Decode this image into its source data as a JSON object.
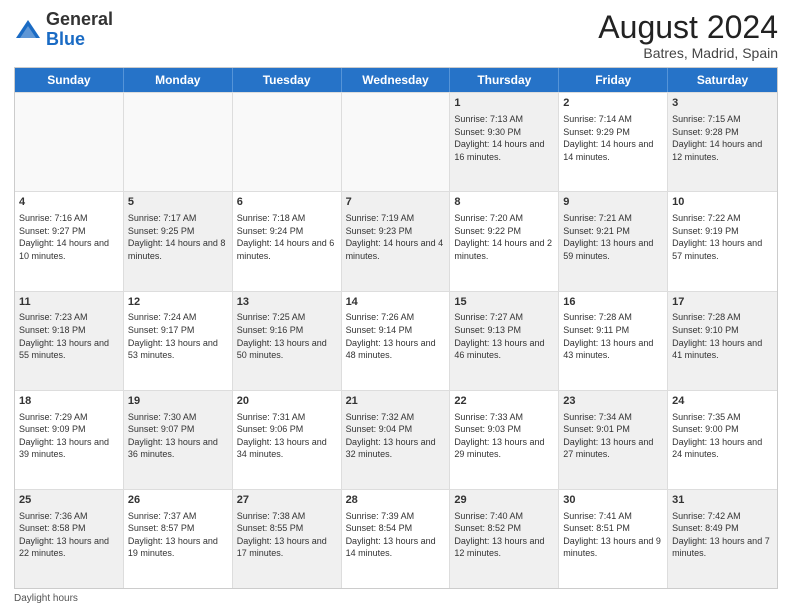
{
  "header": {
    "logo_general": "General",
    "logo_blue": "Blue",
    "month_year": "August 2024",
    "location": "Batres, Madrid, Spain"
  },
  "days_of_week": [
    "Sunday",
    "Monday",
    "Tuesday",
    "Wednesday",
    "Thursday",
    "Friday",
    "Saturday"
  ],
  "weeks": [
    [
      {
        "day": "",
        "sunrise": "",
        "sunset": "",
        "daylight": "",
        "shaded": false,
        "empty": true
      },
      {
        "day": "",
        "sunrise": "",
        "sunset": "",
        "daylight": "",
        "shaded": false,
        "empty": true
      },
      {
        "day": "",
        "sunrise": "",
        "sunset": "",
        "daylight": "",
        "shaded": false,
        "empty": true
      },
      {
        "day": "",
        "sunrise": "",
        "sunset": "",
        "daylight": "",
        "shaded": false,
        "empty": true
      },
      {
        "day": "1",
        "sunrise": "Sunrise: 7:13 AM",
        "sunset": "Sunset: 9:30 PM",
        "daylight": "Daylight: 14 hours and 16 minutes.",
        "shaded": true,
        "empty": false
      },
      {
        "day": "2",
        "sunrise": "Sunrise: 7:14 AM",
        "sunset": "Sunset: 9:29 PM",
        "daylight": "Daylight: 14 hours and 14 minutes.",
        "shaded": false,
        "empty": false
      },
      {
        "day": "3",
        "sunrise": "Sunrise: 7:15 AM",
        "sunset": "Sunset: 9:28 PM",
        "daylight": "Daylight: 14 hours and 12 minutes.",
        "shaded": true,
        "empty": false
      }
    ],
    [
      {
        "day": "4",
        "sunrise": "Sunrise: 7:16 AM",
        "sunset": "Sunset: 9:27 PM",
        "daylight": "Daylight: 14 hours and 10 minutes.",
        "shaded": false,
        "empty": false
      },
      {
        "day": "5",
        "sunrise": "Sunrise: 7:17 AM",
        "sunset": "Sunset: 9:25 PM",
        "daylight": "Daylight: 14 hours and 8 minutes.",
        "shaded": true,
        "empty": false
      },
      {
        "day": "6",
        "sunrise": "Sunrise: 7:18 AM",
        "sunset": "Sunset: 9:24 PM",
        "daylight": "Daylight: 14 hours and 6 minutes.",
        "shaded": false,
        "empty": false
      },
      {
        "day": "7",
        "sunrise": "Sunrise: 7:19 AM",
        "sunset": "Sunset: 9:23 PM",
        "daylight": "Daylight: 14 hours and 4 minutes.",
        "shaded": true,
        "empty": false
      },
      {
        "day": "8",
        "sunrise": "Sunrise: 7:20 AM",
        "sunset": "Sunset: 9:22 PM",
        "daylight": "Daylight: 14 hours and 2 minutes.",
        "shaded": false,
        "empty": false
      },
      {
        "day": "9",
        "sunrise": "Sunrise: 7:21 AM",
        "sunset": "Sunset: 9:21 PM",
        "daylight": "Daylight: 13 hours and 59 minutes.",
        "shaded": true,
        "empty": false
      },
      {
        "day": "10",
        "sunrise": "Sunrise: 7:22 AM",
        "sunset": "Sunset: 9:19 PM",
        "daylight": "Daylight: 13 hours and 57 minutes.",
        "shaded": false,
        "empty": false
      }
    ],
    [
      {
        "day": "11",
        "sunrise": "Sunrise: 7:23 AM",
        "sunset": "Sunset: 9:18 PM",
        "daylight": "Daylight: 13 hours and 55 minutes.",
        "shaded": true,
        "empty": false
      },
      {
        "day": "12",
        "sunrise": "Sunrise: 7:24 AM",
        "sunset": "Sunset: 9:17 PM",
        "daylight": "Daylight: 13 hours and 53 minutes.",
        "shaded": false,
        "empty": false
      },
      {
        "day": "13",
        "sunrise": "Sunrise: 7:25 AM",
        "sunset": "Sunset: 9:16 PM",
        "daylight": "Daylight: 13 hours and 50 minutes.",
        "shaded": true,
        "empty": false
      },
      {
        "day": "14",
        "sunrise": "Sunrise: 7:26 AM",
        "sunset": "Sunset: 9:14 PM",
        "daylight": "Daylight: 13 hours and 48 minutes.",
        "shaded": false,
        "empty": false
      },
      {
        "day": "15",
        "sunrise": "Sunrise: 7:27 AM",
        "sunset": "Sunset: 9:13 PM",
        "daylight": "Daylight: 13 hours and 46 minutes.",
        "shaded": true,
        "empty": false
      },
      {
        "day": "16",
        "sunrise": "Sunrise: 7:28 AM",
        "sunset": "Sunset: 9:11 PM",
        "daylight": "Daylight: 13 hours and 43 minutes.",
        "shaded": false,
        "empty": false
      },
      {
        "day": "17",
        "sunrise": "Sunrise: 7:28 AM",
        "sunset": "Sunset: 9:10 PM",
        "daylight": "Daylight: 13 hours and 41 minutes.",
        "shaded": true,
        "empty": false
      }
    ],
    [
      {
        "day": "18",
        "sunrise": "Sunrise: 7:29 AM",
        "sunset": "Sunset: 9:09 PM",
        "daylight": "Daylight: 13 hours and 39 minutes.",
        "shaded": false,
        "empty": false
      },
      {
        "day": "19",
        "sunrise": "Sunrise: 7:30 AM",
        "sunset": "Sunset: 9:07 PM",
        "daylight": "Daylight: 13 hours and 36 minutes.",
        "shaded": true,
        "empty": false
      },
      {
        "day": "20",
        "sunrise": "Sunrise: 7:31 AM",
        "sunset": "Sunset: 9:06 PM",
        "daylight": "Daylight: 13 hours and 34 minutes.",
        "shaded": false,
        "empty": false
      },
      {
        "day": "21",
        "sunrise": "Sunrise: 7:32 AM",
        "sunset": "Sunset: 9:04 PM",
        "daylight": "Daylight: 13 hours and 32 minutes.",
        "shaded": true,
        "empty": false
      },
      {
        "day": "22",
        "sunrise": "Sunrise: 7:33 AM",
        "sunset": "Sunset: 9:03 PM",
        "daylight": "Daylight: 13 hours and 29 minutes.",
        "shaded": false,
        "empty": false
      },
      {
        "day": "23",
        "sunrise": "Sunrise: 7:34 AM",
        "sunset": "Sunset: 9:01 PM",
        "daylight": "Daylight: 13 hours and 27 minutes.",
        "shaded": true,
        "empty": false
      },
      {
        "day": "24",
        "sunrise": "Sunrise: 7:35 AM",
        "sunset": "Sunset: 9:00 PM",
        "daylight": "Daylight: 13 hours and 24 minutes.",
        "shaded": false,
        "empty": false
      }
    ],
    [
      {
        "day": "25",
        "sunrise": "Sunrise: 7:36 AM",
        "sunset": "Sunset: 8:58 PM",
        "daylight": "Daylight: 13 hours and 22 minutes.",
        "shaded": true,
        "empty": false
      },
      {
        "day": "26",
        "sunrise": "Sunrise: 7:37 AM",
        "sunset": "Sunset: 8:57 PM",
        "daylight": "Daylight: 13 hours and 19 minutes.",
        "shaded": false,
        "empty": false
      },
      {
        "day": "27",
        "sunrise": "Sunrise: 7:38 AM",
        "sunset": "Sunset: 8:55 PM",
        "daylight": "Daylight: 13 hours and 17 minutes.",
        "shaded": true,
        "empty": false
      },
      {
        "day": "28",
        "sunrise": "Sunrise: 7:39 AM",
        "sunset": "Sunset: 8:54 PM",
        "daylight": "Daylight: 13 hours and 14 minutes.",
        "shaded": false,
        "empty": false
      },
      {
        "day": "29",
        "sunrise": "Sunrise: 7:40 AM",
        "sunset": "Sunset: 8:52 PM",
        "daylight": "Daylight: 13 hours and 12 minutes.",
        "shaded": true,
        "empty": false
      },
      {
        "day": "30",
        "sunrise": "Sunrise: 7:41 AM",
        "sunset": "Sunset: 8:51 PM",
        "daylight": "Daylight: 13 hours and 9 minutes.",
        "shaded": false,
        "empty": false
      },
      {
        "day": "31",
        "sunrise": "Sunrise: 7:42 AM",
        "sunset": "Sunset: 8:49 PM",
        "daylight": "Daylight: 13 hours and 7 minutes.",
        "shaded": true,
        "empty": false
      }
    ]
  ],
  "footer": "Daylight hours"
}
